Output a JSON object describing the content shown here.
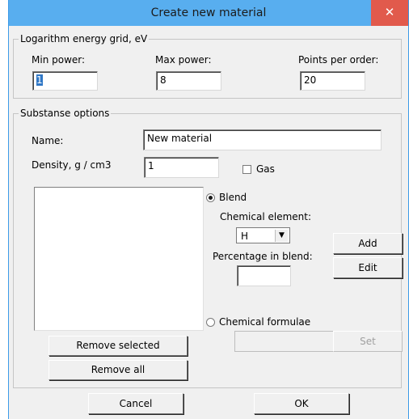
{
  "window": {
    "title": "Create new material",
    "close_glyph": "✕"
  },
  "energy_grid": {
    "legend": "Logarithm energy grid, eV",
    "min_power_label": "Min power:",
    "min_power_value": "1",
    "max_power_label": "Max power:",
    "max_power_value": "8",
    "points_label": "Points per order:",
    "points_value": "20"
  },
  "substance": {
    "legend": "Substanse options",
    "name_label": "Name:",
    "name_value": "New material",
    "density_label": "Density, g / cm3",
    "density_value": "1",
    "gas_label": "Gas",
    "gas_checked": false,
    "blend_label": "Blend",
    "blend_selected": true,
    "element_label": "Chemical element:",
    "element_value": "H",
    "percentage_label": "Percentage in blend:",
    "percentage_value": "",
    "add_label": "Add",
    "edit_label": "Edit",
    "formulae_label": "Chemical formulae",
    "formulae_value": "",
    "set_label": "Set",
    "remove_selected_label": "Remove selected",
    "remove_all_label": "Remove all",
    "blend_items": []
  },
  "footer": {
    "cancel_label": "Cancel",
    "ok_label": "OK"
  },
  "colors": {
    "titlebar": "#58aeef",
    "close": "#e15a4c",
    "dialog_bg": "#f0f0f0"
  }
}
